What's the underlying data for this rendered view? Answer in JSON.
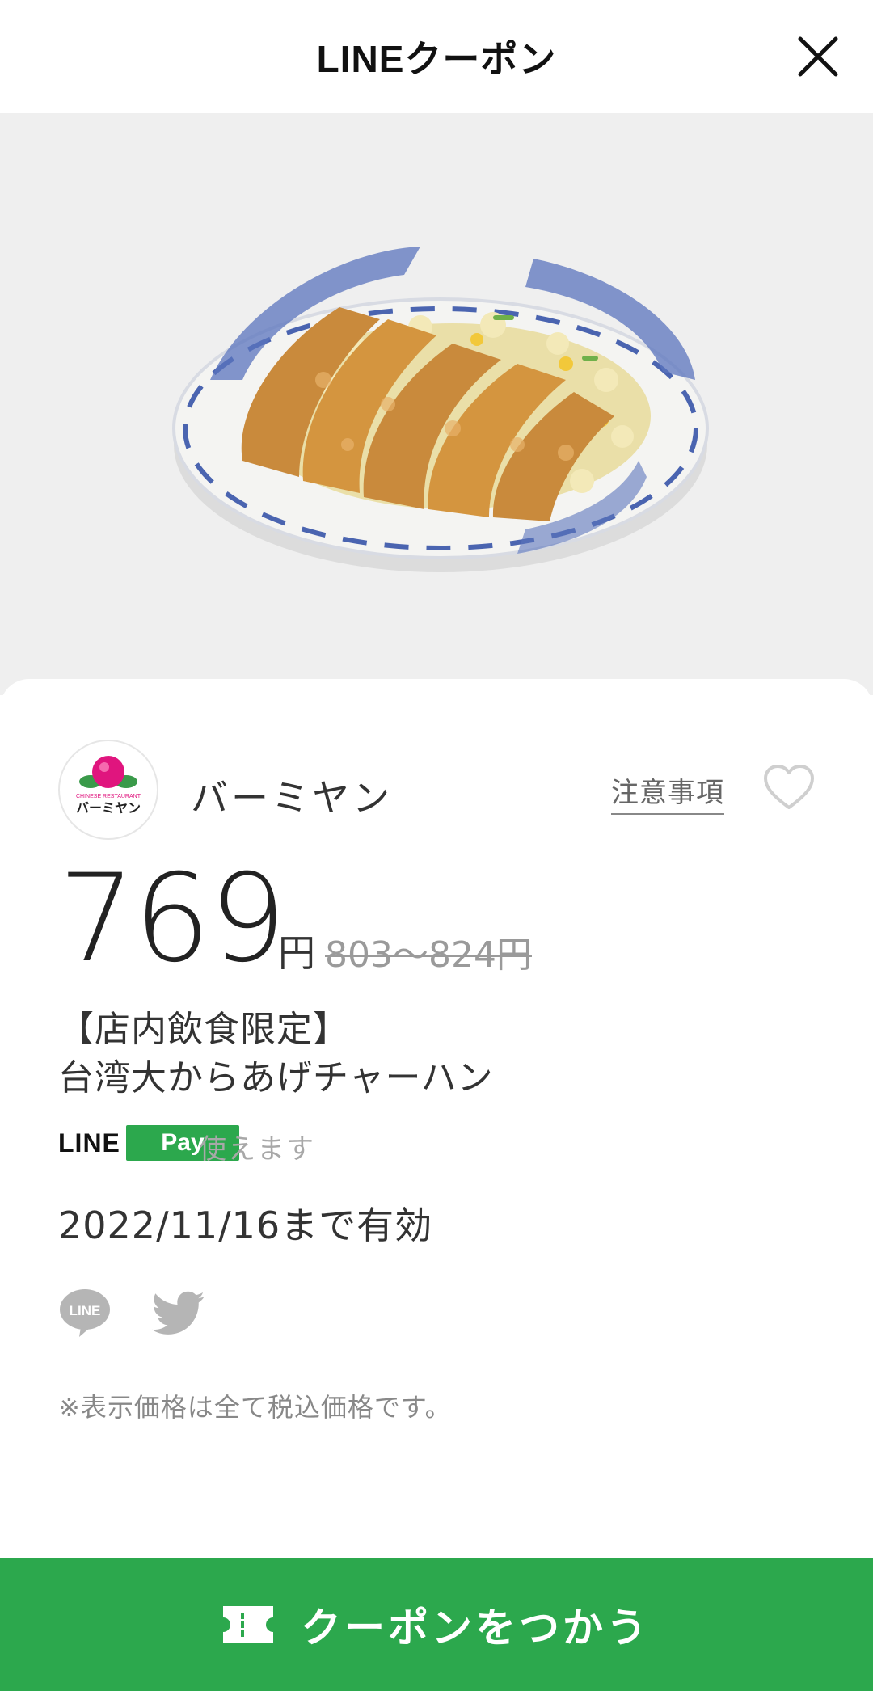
{
  "header": {
    "title": "LINEクーポン",
    "close_icon": "close-icon"
  },
  "hero": {
    "image_icon": "fried-chicken-rice-plate-photo"
  },
  "shop": {
    "logo_text_top": "CHINESE RESTAURANT",
    "logo_text_main": "バーミヤン",
    "name": "バーミヤン",
    "notes_label": "注意事項",
    "favorite_icon": "heart-icon"
  },
  "price": {
    "value": "769",
    "unit": "円",
    "original": "803〜824円"
  },
  "coupon": {
    "title_line1": "【店内飲食限定】",
    "title_line2": "台湾大からあげチャーハン"
  },
  "linepay": {
    "line_text": "LINE",
    "pay_text": "Pay",
    "status": "使えます"
  },
  "validity": "2022/11/16まで有効",
  "share": {
    "line_icon": "line-share-icon",
    "line_icon_text": "LINE",
    "twitter_icon": "twitter-icon"
  },
  "tax_note": "※表示価格は全て税込価格です。",
  "cta": {
    "label": "クーポンをつかう",
    "icon": "ticket-icon",
    "color": "#2ca84d"
  }
}
